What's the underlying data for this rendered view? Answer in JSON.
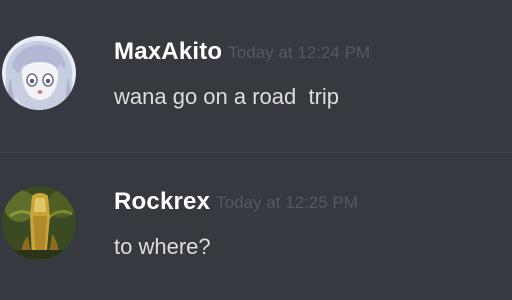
{
  "messages": [
    {
      "username": "MaxAkito",
      "timestamp": "Today at 12:24 PM",
      "content": "wana go on a road  trip",
      "avatar_icon": "anime-character-avatar"
    },
    {
      "username": "Rockrex",
      "timestamp": "Today at 12:25 PM",
      "content": "to where?",
      "avatar_icon": "forest-character-avatar"
    }
  ],
  "colors": {
    "background": "#36393f",
    "username": "#ffffff",
    "timestamp": "#56595f",
    "message_text": "#dcddde",
    "divider": "#3f4248"
  }
}
